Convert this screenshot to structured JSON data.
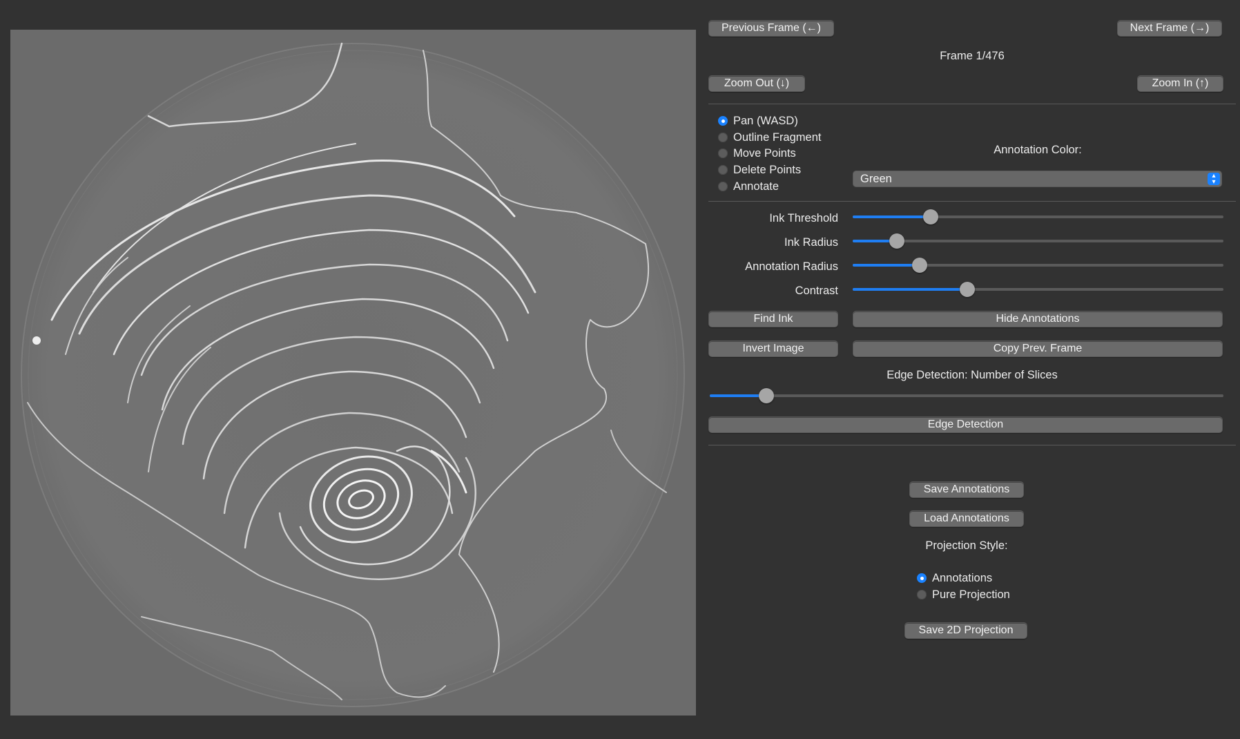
{
  "nav": {
    "prev_label": "Previous Frame (←)",
    "next_label": "Next Frame (→)",
    "frame_label": "Frame 1/476",
    "zoom_out_label": "Zoom Out (↓)",
    "zoom_in_label": "Zoom In (↑)"
  },
  "tools": {
    "items": [
      {
        "label": "Pan (WASD)",
        "selected": true
      },
      {
        "label": "Outline Fragment",
        "selected": false
      },
      {
        "label": "Move Points",
        "selected": false
      },
      {
        "label": "Delete Points",
        "selected": false
      },
      {
        "label": "Annotate",
        "selected": false
      }
    ],
    "annotation_color_label": "Annotation Color:",
    "annotation_color_value": "Green"
  },
  "sliders": {
    "ink_threshold": {
      "label": "Ink Threshold",
      "fraction": 0.21
    },
    "ink_radius": {
      "label": "Ink Radius",
      "fraction": 0.12
    },
    "annotation_radius": {
      "label": "Annotation Radius",
      "fraction": 0.18
    },
    "contrast": {
      "label": "Contrast",
      "fraction": 0.31
    },
    "edge_slices": {
      "label": "Edge Detection: Number of Slices",
      "fraction": 0.11
    }
  },
  "actions": {
    "find_ink": "Find Ink",
    "hide_annotations": "Hide Annotations",
    "invert_image": "Invert Image",
    "copy_prev_frame": "Copy Prev. Frame",
    "edge_detection": "Edge Detection",
    "save_annotations": "Save Annotations",
    "load_annotations": "Load Annotations",
    "save_2d_projection": "Save 2D Projection"
  },
  "projection": {
    "label": "Projection Style:",
    "options": [
      {
        "label": "Annotations",
        "selected": true
      },
      {
        "label": "Pure Projection",
        "selected": false
      }
    ]
  },
  "colors": {
    "accent": "#1a82ff",
    "background": "#323232",
    "viewer_gray": "#6b6b6b"
  }
}
